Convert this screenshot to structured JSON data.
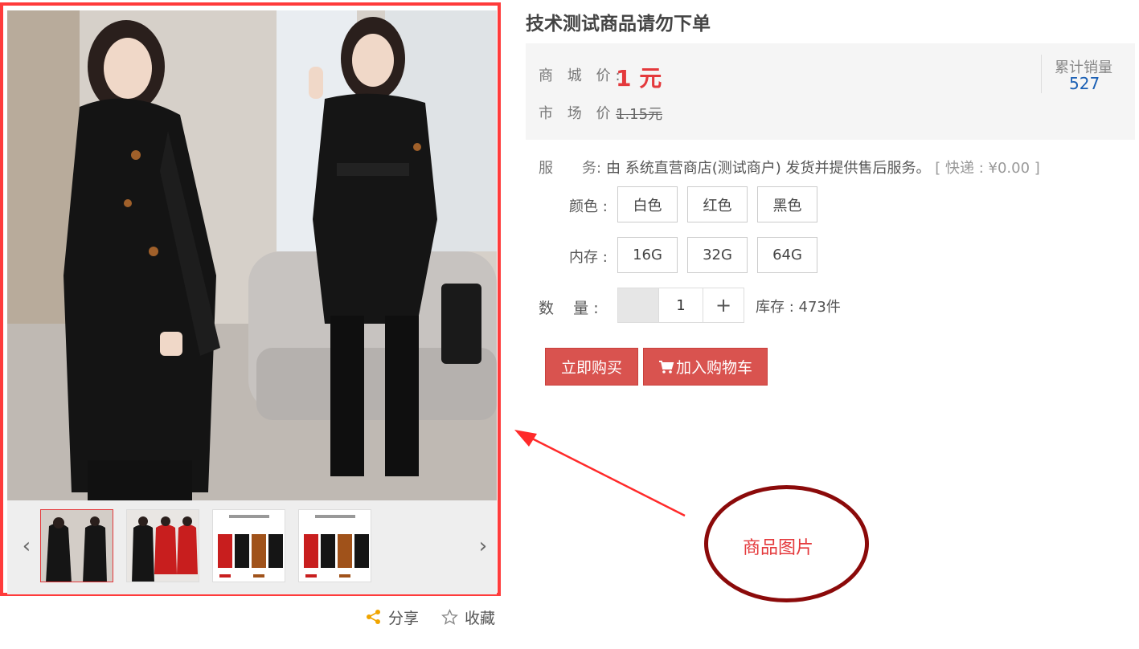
{
  "product": {
    "title": "技术测试商品请勿下单",
    "mall_price_label": "商 城 价:",
    "mall_price": "1 元",
    "market_price_label": "市 场 价:",
    "market_price": "1.15元",
    "sales_label": "累计销量",
    "sales_count": "527"
  },
  "service": {
    "label_a": "服",
    "label_b": "务:",
    "text": "由 系统直营商店(测试商户) 发货并提供售后服务。",
    "express": "[ 快递 : ¥0.00 ]"
  },
  "specs": {
    "color_label": "颜色 :",
    "colors": [
      "白色",
      "红色",
      "黑色"
    ],
    "memory_label": "内存 :",
    "memory": [
      "16G",
      "32G",
      "64G"
    ]
  },
  "quantity": {
    "label": "数    量 :",
    "value": "1",
    "plus": "+",
    "stock": "库存 : 473件"
  },
  "buttons": {
    "buy_now": "立即购买",
    "add_cart": "加入购物车"
  },
  "gallery": {
    "prev": "‹",
    "next": "›",
    "thumbnails": 4,
    "active_index": 0
  },
  "actions": {
    "share": "分享",
    "favorite": "收藏"
  },
  "annotation": {
    "text": "商品图片",
    "color": "#e4393c",
    "ellipse_color": "#8b0a0a"
  },
  "colors": {
    "frame": "#ff3b3b",
    "price": "#e4393c",
    "button": "#d9534f",
    "sales": "#1a5fb4"
  }
}
